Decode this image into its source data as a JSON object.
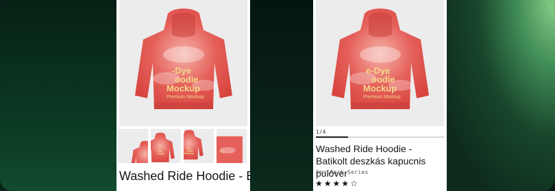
{
  "colors": {
    "hoodie": "#e0574f",
    "hoodie_light": "#f4a49b",
    "print": "#f3d98c",
    "panel_bg": "#ececec"
  },
  "product": {
    "print_lines": [
      "-Dye",
      "oodie",
      "Mockup"
    ],
    "print_sub": "Premium Mockup",
    "print_short": [
      "e-Dye",
      "oodie",
      "Mockup"
    ]
  },
  "left_card": {
    "title": "Washed Ride Hoodie - Batikolt deszkás kapucnis",
    "thumbnail_count": 4
  },
  "right_card": {
    "counter": "1/4",
    "progress": 0.25,
    "title": "Washed Ride Hoodie - Batikolt deszkás kapucnis pulóver",
    "brand": "Spotmark Series",
    "rating": {
      "value": 4,
      "max": 5,
      "filled_icon": "star-filled-icon",
      "empty_icon": "star-empty-icon"
    }
  }
}
